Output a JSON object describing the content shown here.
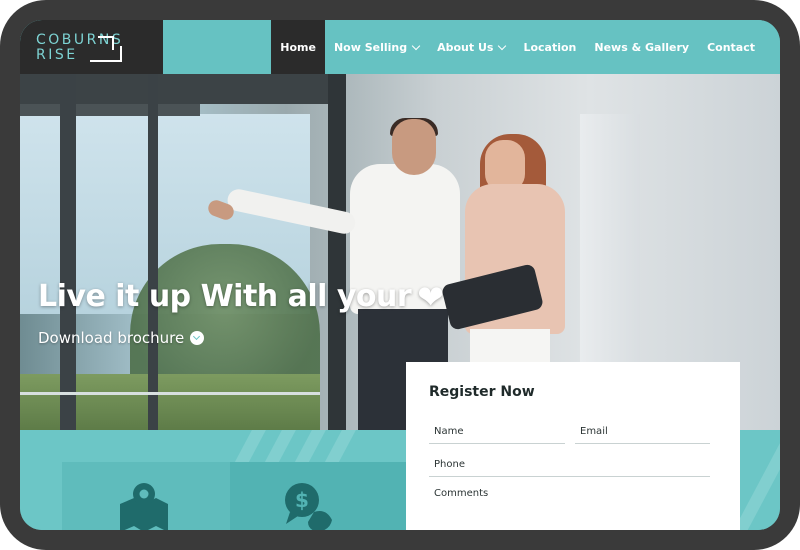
{
  "brand": {
    "logo_line1": "COBURNS",
    "logo_line2": "RISE"
  },
  "nav": {
    "items": [
      {
        "label": "Home",
        "active": true,
        "dropdown": false
      },
      {
        "label": "Now Selling",
        "active": false,
        "dropdown": true
      },
      {
        "label": "About Us",
        "active": false,
        "dropdown": true
      },
      {
        "label": "Location",
        "active": false,
        "dropdown": false
      },
      {
        "label": "News & Gallery",
        "active": false,
        "dropdown": false
      },
      {
        "label": "Contact",
        "active": false,
        "dropdown": false
      }
    ]
  },
  "hero": {
    "title": "Live it up With all your",
    "title_icon": "heart-icon",
    "cta_label": "Download brochure",
    "cta_icon": "chevron-circle-down-icon"
  },
  "form": {
    "title": "Register Now",
    "name_placeholder": "Name",
    "email_placeholder": "Email",
    "phone_placeholder": "Phone",
    "comments_placeholder": "Comments"
  },
  "features": {
    "icons": [
      "map-pin-icon",
      "money-chat-icon"
    ]
  },
  "colors": {
    "accent": "#66c2c2",
    "dark": "#2b2b2b",
    "logo_text": "#7dd3d3",
    "white": "#ffffff"
  }
}
